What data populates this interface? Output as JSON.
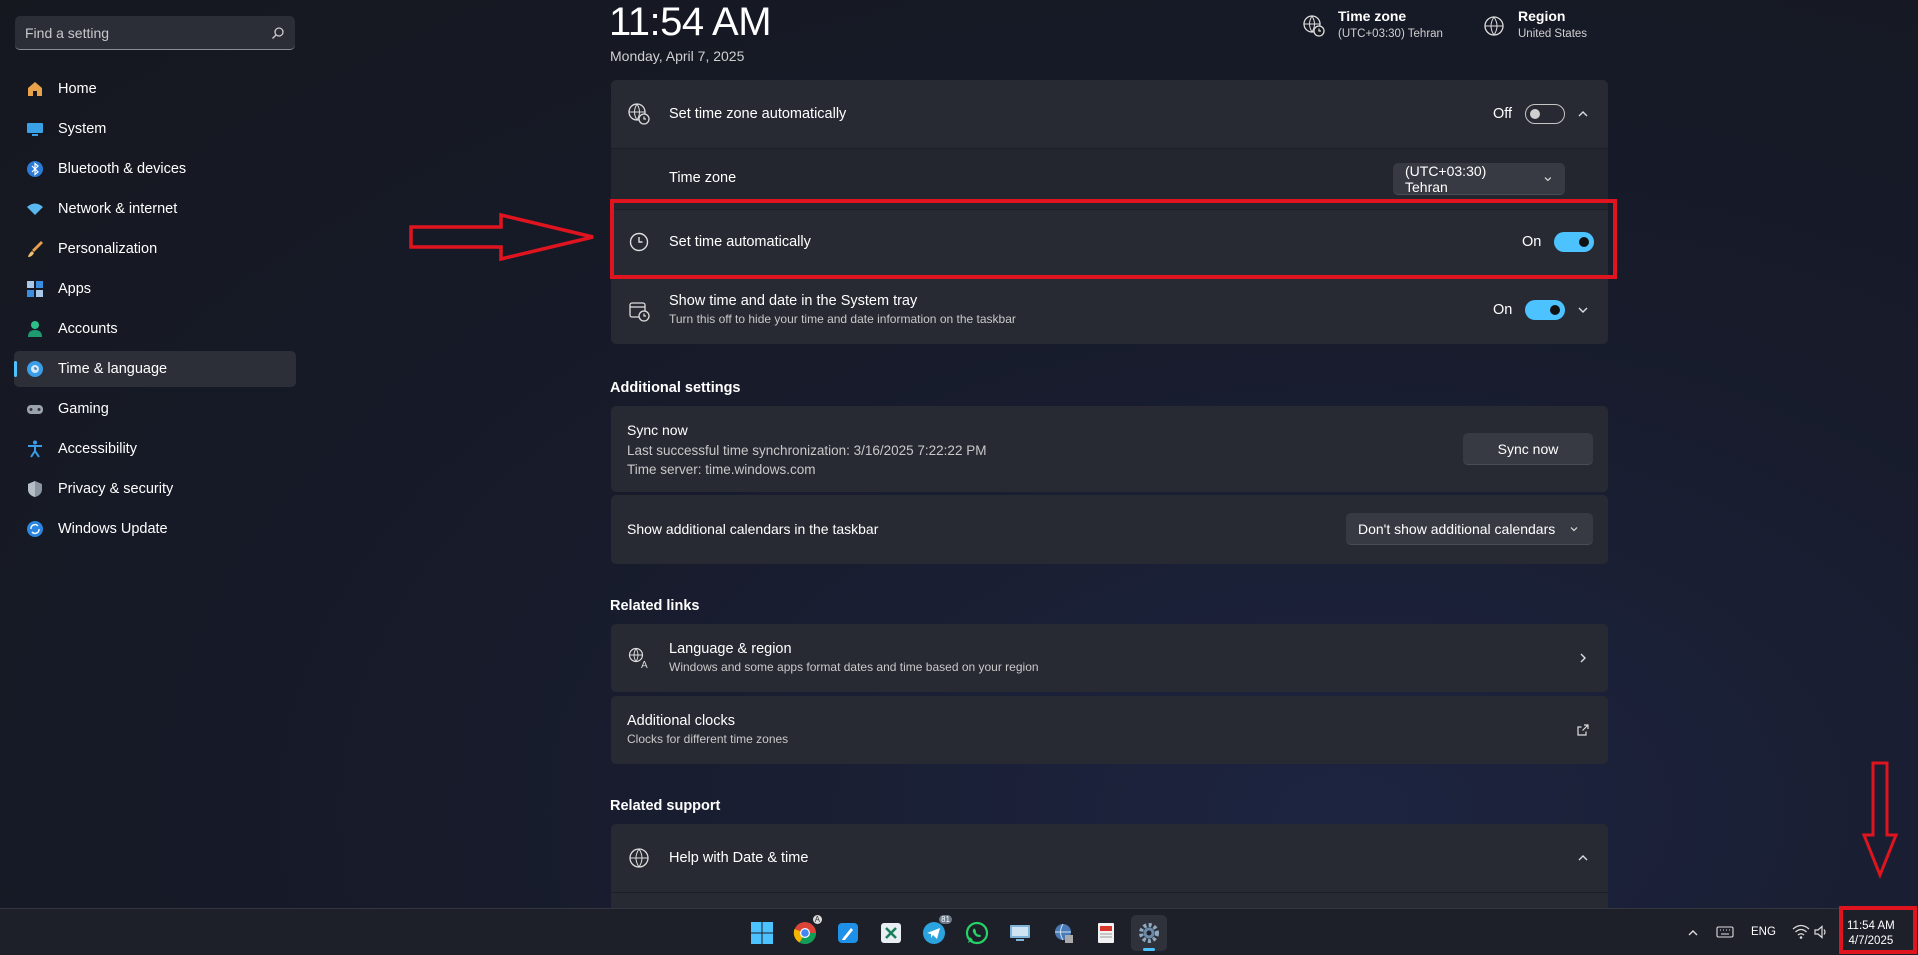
{
  "search": {
    "placeholder": "Find a setting"
  },
  "sidebar": {
    "items": [
      {
        "label": "Home"
      },
      {
        "label": "System"
      },
      {
        "label": "Bluetooth & devices"
      },
      {
        "label": "Network & internet"
      },
      {
        "label": "Personalization"
      },
      {
        "label": "Apps"
      },
      {
        "label": "Accounts"
      },
      {
        "label": "Time & language"
      },
      {
        "label": "Gaming"
      },
      {
        "label": "Accessibility"
      },
      {
        "label": "Privacy & security"
      },
      {
        "label": "Windows Update"
      }
    ],
    "active_index": 7
  },
  "header": {
    "time": "11:54 AM",
    "date": "Monday, April 7, 2025",
    "timezone_title": "Time zone",
    "timezone_value": "(UTC+03:30) Tehran",
    "region_title": "Region",
    "region_value": "United States"
  },
  "settings": {
    "auto_timezone": {
      "label": "Set time zone automatically",
      "state": "Off"
    },
    "time_zone": {
      "label": "Time zone",
      "value": "(UTC+03:30) Tehran"
    },
    "auto_time": {
      "label": "Set time automatically",
      "state": "On"
    },
    "tray": {
      "label": "Show time and date in the System tray",
      "desc": "Turn this off to hide your time and date information on the taskbar",
      "state": "On"
    }
  },
  "additional": {
    "title": "Additional settings",
    "sync_title": "Sync now",
    "sync_last": "Last successful time synchronization: 3/16/2025 7:22:22 PM",
    "sync_server": "Time server: time.windows.com",
    "sync_button": "Sync now",
    "calendars_label": "Show additional calendars in the taskbar",
    "calendars_value": "Don't show additional calendars"
  },
  "related_links": {
    "title": "Related links",
    "lang_title": "Language & region",
    "lang_desc": "Windows and some apps format dates and time based on your region",
    "clocks_title": "Additional clocks",
    "clocks_desc": "Clocks for different time zones"
  },
  "related_support": {
    "title": "Related support",
    "help_title": "Help with Date & time"
  },
  "taskbar": {
    "lang": "ENG",
    "clock_time": "11:54 AM",
    "clock_date": "4/7/2025",
    "telegram_badge": "81",
    "chrome_badge": "A"
  },
  "colors": {
    "accent": "#4cc2ff",
    "annotation": "#e0141f"
  }
}
